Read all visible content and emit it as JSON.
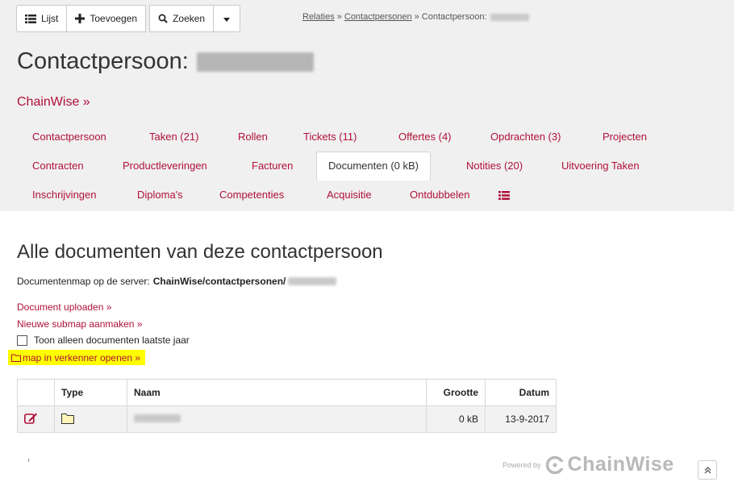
{
  "toolbar": {
    "list_label": "Lijst",
    "add_label": "Toevoegen",
    "search_label": "Zoeken",
    "dropdown_icon": "caret-down-icon"
  },
  "breadcrumb": {
    "items": [
      "Relaties",
      "Contactpersonen",
      "Contactpersoon:"
    ],
    "separator": "»"
  },
  "page": {
    "title": "Contactpersoon:",
    "company_link": "ChainWise »"
  },
  "tabs": {
    "row1": [
      "Contactpersoon",
      "Taken (21)",
      "Rollen",
      "Tickets (11)",
      "Offertes (4)",
      "Opdrachten (3)",
      "Projecten"
    ],
    "row2": [
      "Contracten",
      "Productleveringen",
      "Facturen",
      "Documenten (0 kB)",
      "Notities (20)",
      "Uitvoering Taken"
    ],
    "row3": [
      "Inschrijvingen",
      "Diploma's",
      "Competenties",
      "Acquisitie",
      "Ontdubbelen"
    ],
    "active": "Documenten (0 kB)"
  },
  "documents": {
    "title": "Alle documenten van deze contactpersoon",
    "server_label": "Documentenmap op de server:",
    "server_path": "ChainWise/contactpersonen/",
    "upload_link": "Document uploaden »",
    "subfolder_link": "Nieuwe submap aanmaken »",
    "filter_label": "Toon alleen documenten laatste jaar",
    "filter_checked": false,
    "open_folder_link": "map in verkenner openen »",
    "highlight_color": "#ffff00"
  },
  "table": {
    "headers": [
      "",
      "Type",
      "Naam",
      "Grootte",
      "Datum"
    ],
    "rows": [
      {
        "size": "0 kB",
        "date": "13-9-2017"
      }
    ]
  },
  "footer": {
    "powered_by": "Powered by",
    "brand": "ChainWise",
    "scroll_icon": "double-chevron-up-icon"
  },
  "colors": {
    "accent": "#b0103a",
    "header_bg": "#f0f0f0",
    "row_bg": "#f2f2f2"
  }
}
